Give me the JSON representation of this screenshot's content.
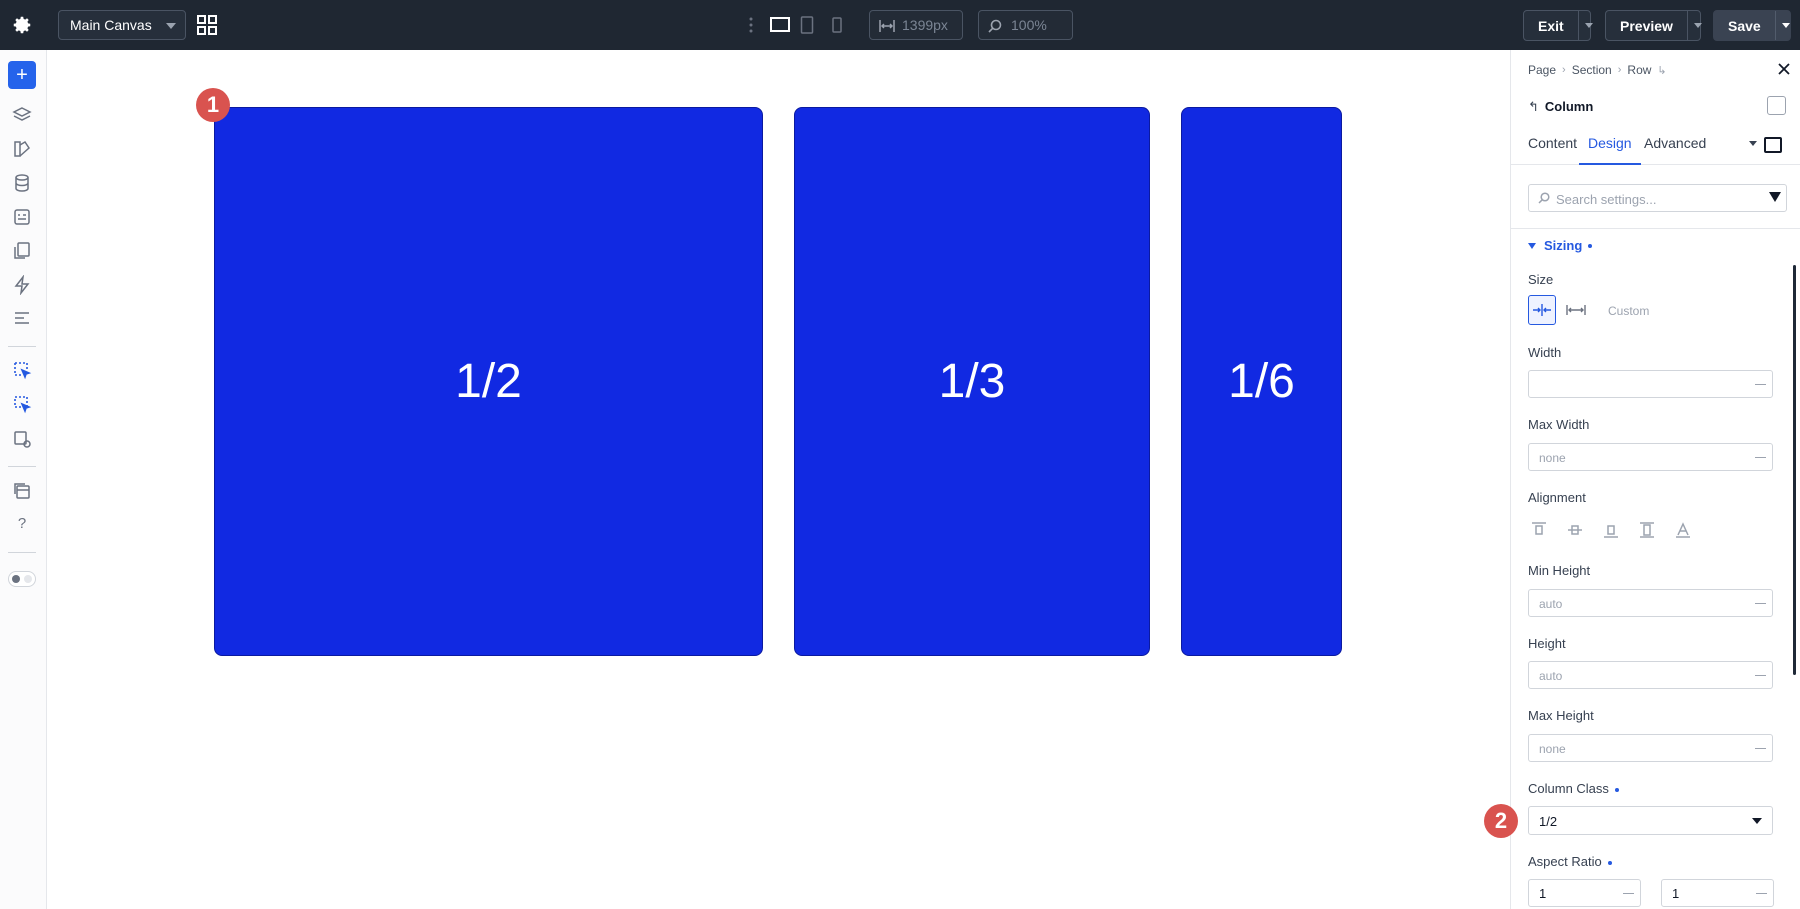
{
  "topbar": {
    "canvas_select": "Main Canvas",
    "width_value": "1399px",
    "zoom_value": "100%",
    "exit_label": "Exit",
    "preview_label": "Preview",
    "save_label": "Save"
  },
  "leftbar": {
    "icons": [
      "add-icon",
      "layers-icon",
      "paint-icon",
      "database-icon",
      "form-icon",
      "pages-icon",
      "bolt-icon",
      "structure-icon",
      "select-template-icon",
      "select-multiple-icon",
      "template-settings-icon",
      "library-icon",
      "help-icon",
      "theme-toggle-icon"
    ],
    "help_label": "?"
  },
  "canvas": {
    "columns": [
      {
        "label": "1/2"
      },
      {
        "label": "1/3"
      },
      {
        "label": "1/6"
      }
    ],
    "badges": [
      "1",
      "2"
    ]
  },
  "panel": {
    "breadcrumb": [
      "Page",
      "Section",
      "Row"
    ],
    "breadcrumb_tail": "↳",
    "title": "Column",
    "tabs": [
      "Content",
      "Design",
      "Advanced"
    ],
    "active_tab": "Design",
    "search_placeholder": "Search settings...",
    "section_title": "Sizing",
    "size_label": "Size",
    "size_custom": "Custom",
    "width_label": "Width",
    "width_value": "",
    "max_width_label": "Max Width",
    "max_width_value": "none",
    "alignment_label": "Alignment",
    "min_height_label": "Min Height",
    "min_height_value": "auto",
    "height_label": "Height",
    "height_value": "auto",
    "max_height_label": "Max Height",
    "max_height_value": "none",
    "column_class_label": "Column Class",
    "column_class_value": "1/2",
    "aspect_ratio_label": "Aspect Ratio",
    "aspect_ratio_w": "1",
    "aspect_ratio_h": "1"
  },
  "colors": {
    "topbar": "#1f2732",
    "accent": "#2559e0",
    "column_fill": "#1129e2",
    "badge": "#d9534f"
  }
}
